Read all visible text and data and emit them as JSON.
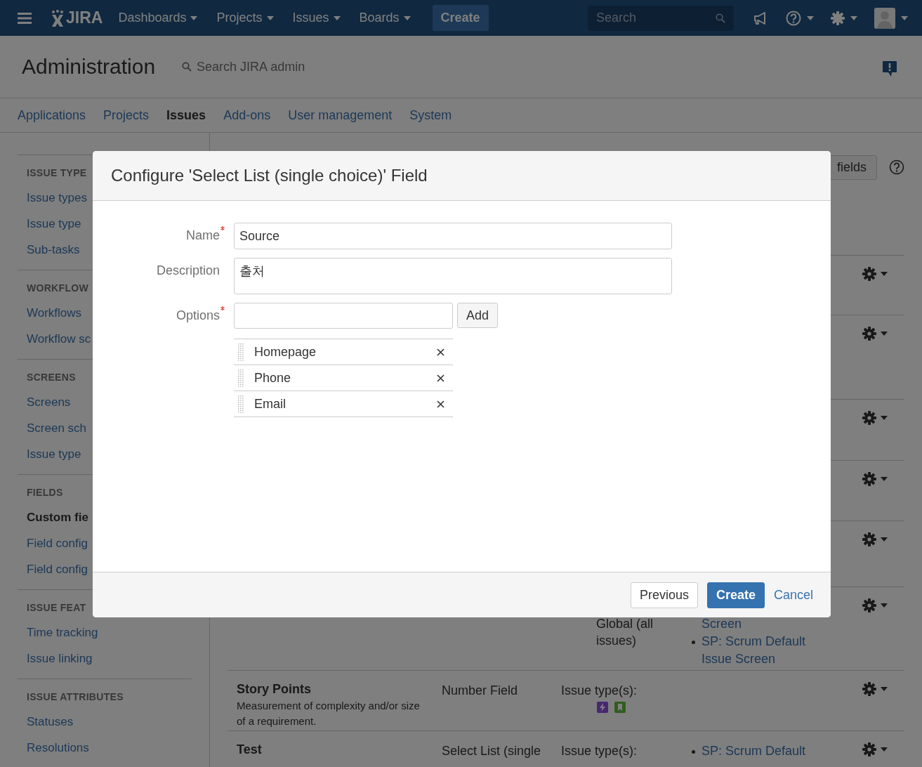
{
  "top_nav": {
    "logo": "JIRA",
    "menus": [
      {
        "label": "Dashboards"
      },
      {
        "label": "Projects"
      },
      {
        "label": "Issues"
      },
      {
        "label": "Boards"
      }
    ],
    "create_button": "Create",
    "search": {
      "placeholder": "Search"
    }
  },
  "admin_header": {
    "title": "Administration",
    "search_link": "Search JIRA admin"
  },
  "admin_tabs": [
    {
      "label": "Applications",
      "selected": false
    },
    {
      "label": "Projects",
      "selected": false
    },
    {
      "label": "Issues",
      "selected": true
    },
    {
      "label": "Add-ons",
      "selected": false
    },
    {
      "label": "User management",
      "selected": false
    },
    {
      "label": "System",
      "selected": false
    }
  ],
  "sidebar": {
    "sections": [
      {
        "heading": "ISSUE TYPE",
        "items": [
          {
            "label": "Issue types",
            "selected": false
          },
          {
            "label": "Issue type",
            "selected": false
          },
          {
            "label": "Sub-tasks",
            "selected": false
          }
        ]
      },
      {
        "heading": "WORKFLOW",
        "items": [
          {
            "label": "Workflows",
            "selected": false
          },
          {
            "label": "Workflow sc",
            "selected": false
          }
        ]
      },
      {
        "heading": "SCREENS",
        "items": [
          {
            "label": "Screens",
            "selected": false
          },
          {
            "label": "Screen sch",
            "selected": false
          },
          {
            "label": "Issue type",
            "selected": false
          }
        ]
      },
      {
        "heading": "FIELDS",
        "items": [
          {
            "label": "Custom fie",
            "selected": true
          },
          {
            "label": "Field config",
            "selected": false
          },
          {
            "label": "Field config",
            "selected": false
          }
        ]
      },
      {
        "heading": "ISSUE FEAT",
        "items": [
          {
            "label": "Time tracking",
            "selected": false
          },
          {
            "label": "Issue linking",
            "selected": false
          }
        ]
      },
      {
        "heading": "ISSUE ATTRIBUTES",
        "items": [
          {
            "label": "Statuses",
            "selected": false
          },
          {
            "label": "Resolutions",
            "selected": false
          }
        ]
      }
    ]
  },
  "content": {
    "partial_button": "fields",
    "rows": [
      {
        "kind": "covered"
      },
      {
        "kind": "covered"
      },
      {
        "kind": "covered"
      },
      {
        "kind": "covered"
      },
      {
        "kind": "covered"
      },
      {
        "kind": "full",
        "context_lines": [
          "Global (all",
          "issues)"
        ],
        "screens": [
          {
            "text": "Screen",
            "bullet": false
          },
          {
            "text": "SP: Scrum Default Issue Screen",
            "bullet": true
          }
        ]
      },
      {
        "kind": "full",
        "name": "Story Points",
        "description": "Measurement of complexity and/or size of a requirement.",
        "type": "Number Field",
        "context_heading": "Issue type(s):",
        "type_icons": [
          {
            "kind": "lightning",
            "color": "#482771"
          },
          {
            "kind": "bookmark",
            "color": "#315d1e"
          }
        ]
      },
      {
        "kind": "full",
        "name": "Test",
        "type": "Select List (single",
        "context_heading": "Issue type(s):",
        "screens": [
          {
            "text": "SP: Scrum Default",
            "bullet": true
          }
        ]
      }
    ]
  },
  "dialog": {
    "title": "Configure 'Select List (single choice)' Field",
    "fields": [
      {
        "kind": "input",
        "label": "Name",
        "required": true,
        "value": "Source"
      },
      {
        "kind": "textarea",
        "label": "Description",
        "required": false,
        "value": "출처"
      },
      {
        "kind": "options",
        "label": "Options",
        "required": true,
        "add_button": "Add"
      }
    ],
    "options": [
      "Homepage",
      "Phone",
      "Email"
    ],
    "buttons": [
      {
        "label": "Previous",
        "kind": "default"
      },
      {
        "label": "Create",
        "kind": "primary"
      },
      {
        "label": "Cancel",
        "kind": "link"
      }
    ]
  }
}
